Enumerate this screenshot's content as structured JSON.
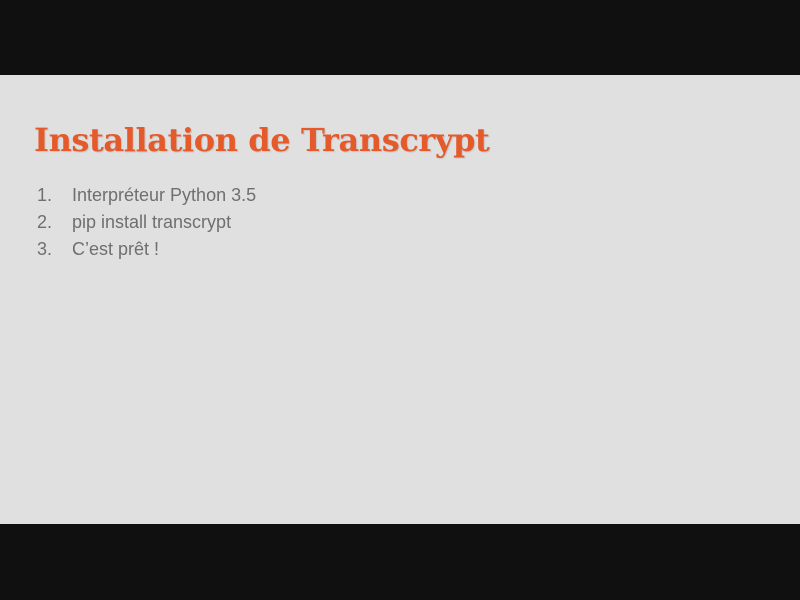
{
  "slide": {
    "title": "Installation de Transcrypt",
    "title_color": "#e55a2b",
    "background_color": "#e0e0e0",
    "text_color": "#6f6f6f",
    "steps": [
      {
        "number": "1.",
        "text": "Interpréteur Python 3.5"
      },
      {
        "number": "2.",
        "text": "pip install transcrypt"
      },
      {
        "number": "3.",
        "text": "C’est prêt !"
      }
    ]
  }
}
